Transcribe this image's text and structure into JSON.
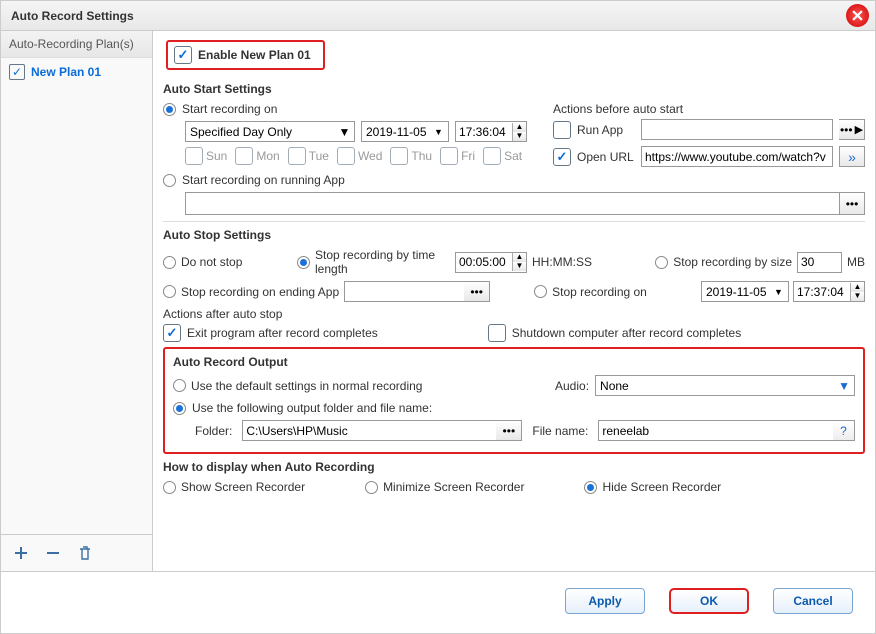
{
  "window": {
    "title": "Auto Record Settings"
  },
  "sidebar": {
    "header": "Auto-Recording Plan(s)",
    "items": [
      {
        "label": "New Plan 01"
      }
    ]
  },
  "enable": {
    "label": "Enable New Plan 01"
  },
  "autostart": {
    "title": "Auto Start Settings",
    "start_on": "Start recording on",
    "schedule": "Specified Day Only",
    "date": "2019-11-05",
    "time": "17:36:04",
    "days": {
      "sun": "Sun",
      "mon": "Mon",
      "tue": "Tue",
      "wed": "Wed",
      "thu": "Thu",
      "fri": "Fri",
      "sat": "Sat"
    },
    "on_running": "Start recording on running App",
    "actions_title": "Actions before auto start",
    "run_app": "Run App",
    "open_url": "Open URL",
    "url_value": "https://www.youtube.com/watch?v"
  },
  "autostop": {
    "title": "Auto Stop Settings",
    "do_not_stop": "Do not stop",
    "by_length": "Stop recording by time length",
    "length_val": "00:05:00",
    "length_unit": "HH:MM:SS",
    "by_size": "Stop recording by size",
    "size_val": "30",
    "size_unit": "MB",
    "on_ending": "Stop recording on ending App",
    "on_time": "Stop recording on",
    "stop_date": "2019-11-05",
    "stop_time": "17:37:04",
    "actions_after": "Actions after auto stop",
    "exit_prog": "Exit program after record completes",
    "shutdown": "Shutdown computer after record completes"
  },
  "output": {
    "title": "Auto Record Output",
    "use_default": "Use the default settings in normal recording",
    "use_following": "Use the following output folder and file name:",
    "audio_lbl": "Audio:",
    "audio_val": "None",
    "folder_lbl": "Folder:",
    "folder_val": "C:\\Users\\HP\\Music",
    "file_lbl": "File name:",
    "file_val": "reneelab"
  },
  "display": {
    "title": "How to display when Auto Recording",
    "show": "Show Screen Recorder",
    "minimize": "Minimize Screen Recorder",
    "hide": "Hide Screen Recorder"
  },
  "buttons": {
    "apply": "Apply",
    "ok": "OK",
    "cancel": "Cancel"
  }
}
